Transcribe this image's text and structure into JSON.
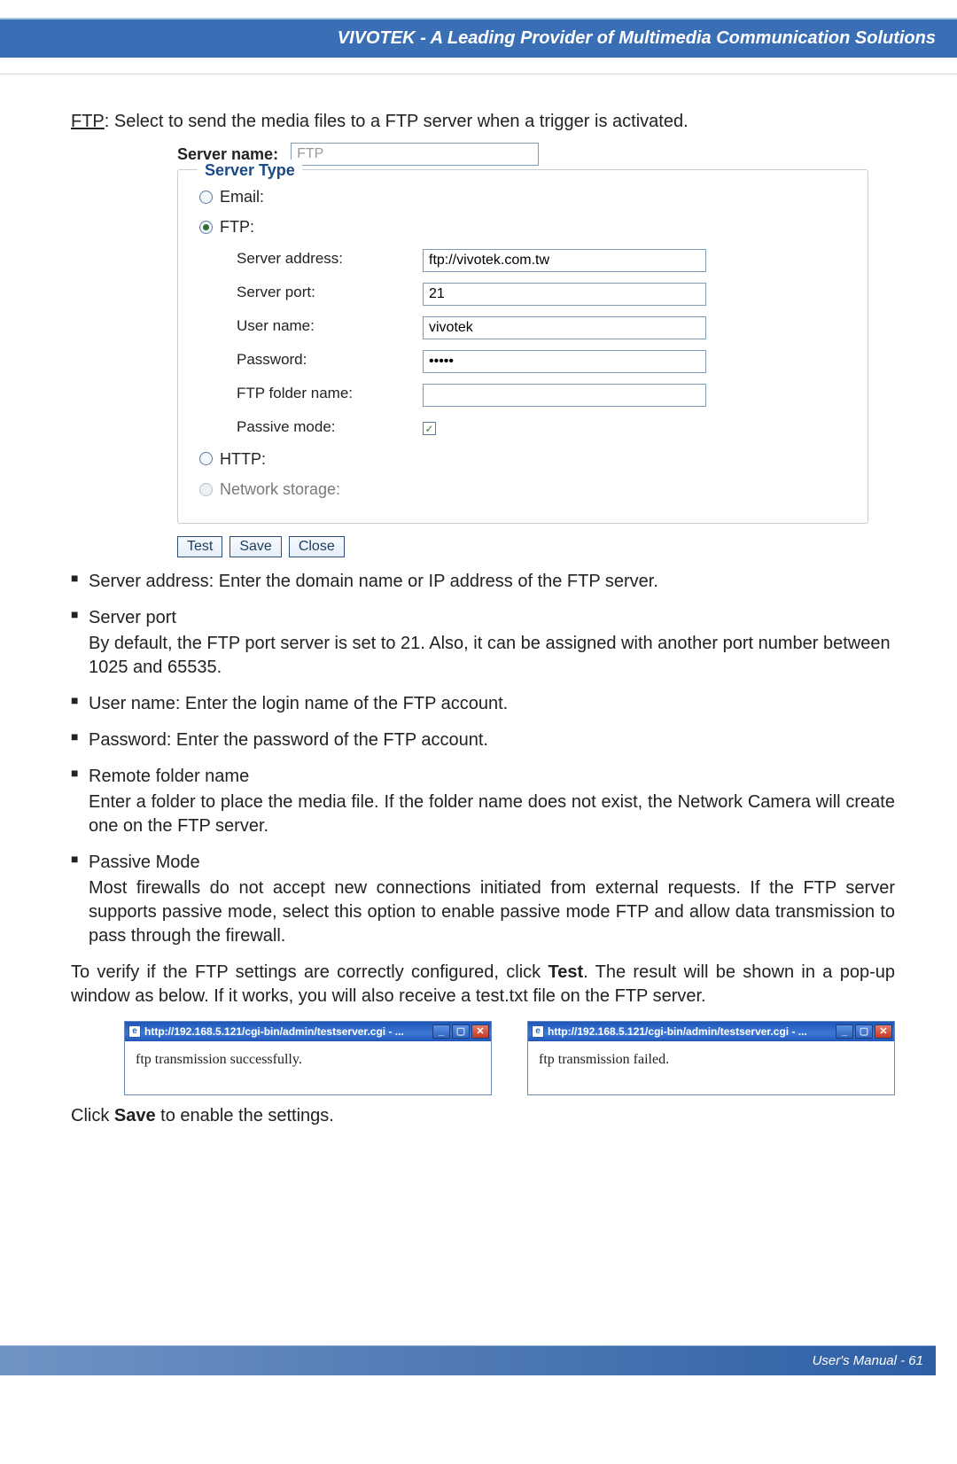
{
  "header": {
    "title": "VIVOTEK - A Leading Provider of Multimedia Communication Solutions"
  },
  "intro": {
    "ftp_label": "FTP",
    "ftp_text": ": Select to send the media files to a FTP server when a trigger is activated."
  },
  "form": {
    "server_name_label": "Server name:",
    "server_name_value": "FTP",
    "fieldset_legend": "Server Type",
    "options": {
      "email_label": "Email:",
      "ftp_label": "FTP:",
      "http_label": "HTTP:",
      "network_storage_label": "Network storage:"
    },
    "ftp": {
      "server_address_label": "Server address:",
      "server_address_value": "ftp://vivotek.com.tw",
      "server_port_label": "Server port:",
      "server_port_value": "21",
      "user_name_label": "User name:",
      "user_name_value": "vivotek",
      "password_label": "Password:",
      "password_value": "•••••",
      "ftp_folder_label": "FTP folder name:",
      "ftp_folder_value": "",
      "passive_mode_label": "Passive mode:",
      "passive_mode_checked": true
    },
    "buttons": {
      "test": "Test",
      "save": "Save",
      "close": "Close"
    }
  },
  "bullets": {
    "server_address": "Server address: Enter the domain name or IP address of the FTP server.",
    "server_port_title": "Server port",
    "server_port_body": "By default, the FTP port server is set to 21. Also, it can be assigned with another port  number between 1025 and 65535.",
    "user_name": "User name: Enter the login name of the FTP account.",
    "password": "Password: Enter the password of the FTP account.",
    "remote_folder_title": "Remote folder name",
    "remote_folder_body": "Enter a folder to place the media file. If the folder name does not exist, the Network Camera will create one on the FTP server.",
    "passive_mode_title": "Passive Mode",
    "passive_mode_body": "Most firewalls do not accept new connections initiated from external requests. If the FTP server supports passive mode, select this option to enable passive mode FTP and allow data transmission to pass through the firewall."
  },
  "verify_para_pre": "To verify if the FTP settings are correctly configured, click ",
  "verify_para_bold": "Test",
  "verify_para_post": ". The result will be shown in a pop-up window as below. If it works, you will also receive a test.txt file on the FTP server.",
  "dialogs": {
    "left": {
      "title": "http://192.168.5.121/cgi-bin/admin/testserver.cgi - ...",
      "body": "ftp transmission successfully."
    },
    "right": {
      "title": "http://192.168.5.121/cgi-bin/admin/testserver.cgi - ...",
      "body": "ftp transmission failed."
    }
  },
  "save_line_pre": "Click ",
  "save_line_bold": "Save",
  "save_line_post": " to enable the settings.",
  "footer": {
    "text": "User's Manual - 61"
  }
}
